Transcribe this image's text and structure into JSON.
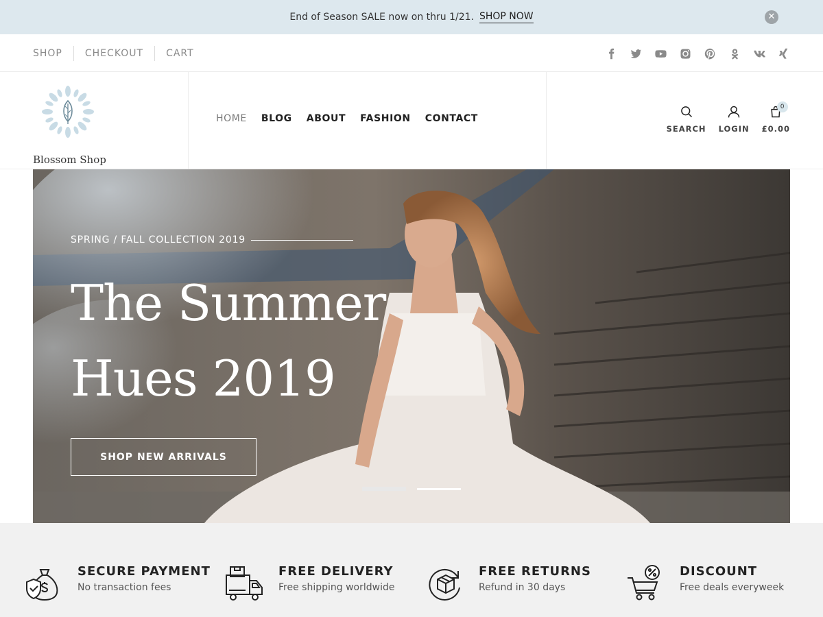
{
  "announcement": {
    "text": "End of Season SALE now on thru 1/21.",
    "link": "SHOP NOW",
    "close_icon": "close-icon"
  },
  "topnav": {
    "items": [
      {
        "label": "SHOP"
      },
      {
        "label": "CHECKOUT"
      },
      {
        "label": "CART"
      }
    ]
  },
  "social": [
    "facebook-icon",
    "twitter-icon",
    "youtube-icon",
    "instagram-icon",
    "pinterest-icon",
    "odnoklassniki-icon",
    "vk-icon",
    "xing-icon"
  ],
  "header": {
    "logo_text": "Blossom Shop",
    "nav": [
      {
        "label": "HOME",
        "active": true
      },
      {
        "label": "BLOG"
      },
      {
        "label": "ABOUT"
      },
      {
        "label": "FASHION"
      },
      {
        "label": "CONTACT"
      }
    ],
    "tools": {
      "search": "SEARCH",
      "login": "LOGIN",
      "cart_total": "£0.00",
      "cart_count": "0"
    }
  },
  "hero": {
    "eyebrow": "SPRING / FALL COLLECTION 2019",
    "title_line1": "The Summer",
    "title_line2": "Hues 2019",
    "cta": "SHOP NEW ARRIVALS",
    "slide_active": 1,
    "slide_count": 2
  },
  "features": [
    {
      "title": "SECURE PAYMENT",
      "subtitle": "No transaction fees",
      "icon": "money-bag-shield-icon"
    },
    {
      "title": "FREE DELIVERY",
      "subtitle": "Free shipping worldwide",
      "icon": "delivery-truck-icon"
    },
    {
      "title": "FREE RETURNS",
      "subtitle": "Refund in 30 days",
      "icon": "return-box-icon"
    },
    {
      "title": "DISCOUNT",
      "subtitle": "Free deals everyweek",
      "icon": "discount-cart-icon"
    }
  ],
  "colors": {
    "announcement_bg": "#dde8ee",
    "features_bg": "#f1f1f1",
    "muted_text": "#8a8a8a"
  }
}
